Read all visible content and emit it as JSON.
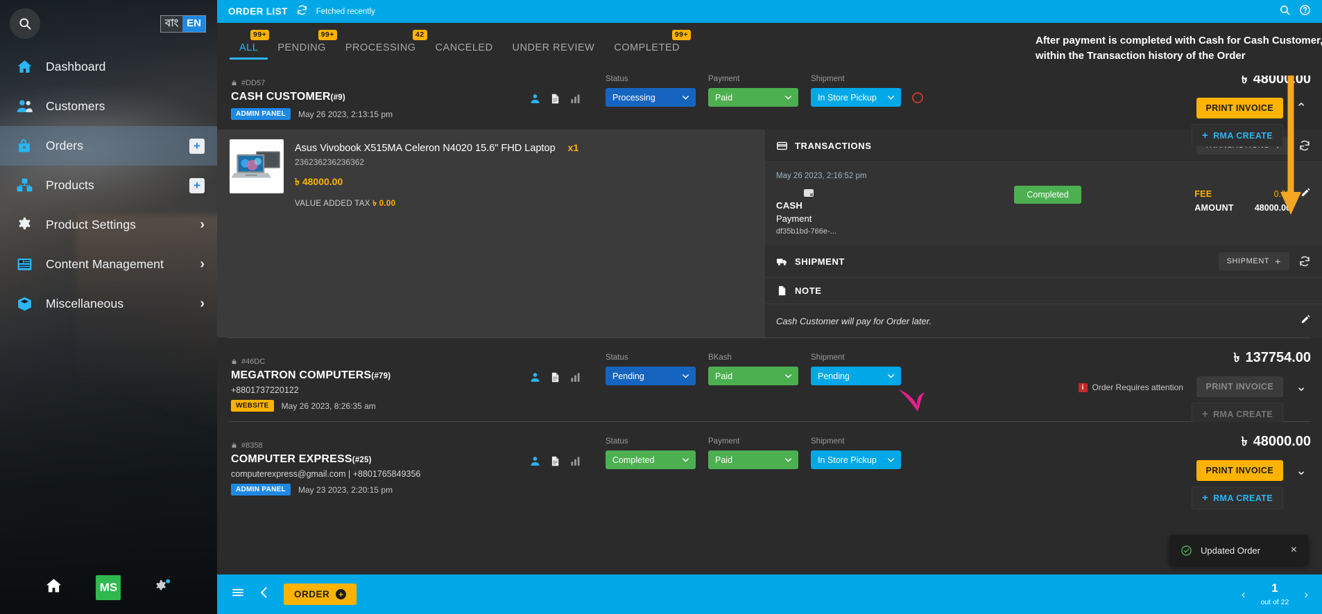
{
  "sidebar": {
    "search_icon": "search-icon",
    "lang": {
      "bn": "বাং",
      "en": "EN"
    },
    "items": [
      {
        "label": "Dashboard",
        "icon": "home-icon",
        "badge": null,
        "chevron": false,
        "active": false
      },
      {
        "label": "Customers",
        "icon": "customers-icon",
        "badge": null,
        "chevron": false,
        "active": false
      },
      {
        "label": "Orders",
        "icon": "orders-icon",
        "badge": "+",
        "chevron": false,
        "active": true
      },
      {
        "label": "Products",
        "icon": "products-icon",
        "badge": "+",
        "chevron": false,
        "active": false
      },
      {
        "label": "Product Settings",
        "icon": "gear-icon",
        "badge": null,
        "chevron": true,
        "active": false
      },
      {
        "label": "Content Management",
        "icon": "content-icon",
        "badge": null,
        "chevron": true,
        "active": false
      },
      {
        "label": "Miscellaneous",
        "icon": "misc-icon",
        "badge": null,
        "chevron": true,
        "active": false
      }
    ],
    "bottom": {
      "home": "home-icon",
      "brand": "MS",
      "settings": "settings-icon"
    }
  },
  "topbar": {
    "title": "ORDER LIST",
    "refresh_icon": "refresh-icon",
    "fetch_status": "Fetched recently",
    "search_icon": "search-icon",
    "help_icon": "help-icon"
  },
  "tabs": [
    {
      "label": "ALL",
      "badge": "99+",
      "active": true
    },
    {
      "label": "PENDING",
      "badge": "99+",
      "active": false
    },
    {
      "label": "PROCESSING",
      "badge": "42",
      "active": false
    },
    {
      "label": "CANCELED",
      "badge": null,
      "active": false
    },
    {
      "label": "UNDER REVIEW",
      "badge": null,
      "active": false
    },
    {
      "label": "COMPLETED",
      "badge": "99+",
      "active": false
    }
  ],
  "callout": {
    "text": "After payment is completed with Cash for Cash Customer, it will show within the Transaction history of the Order"
  },
  "orders": [
    {
      "id": "#DD57",
      "customer": "CASH CUSTOMER",
      "customer_num": "(#9)",
      "contact": "",
      "source_chip": "ADMIN PANEL",
      "source_type": "admin",
      "date": "May 26 2023, 2:13:15 pm",
      "status_label": "Status",
      "status_value": "Processing",
      "status_color": "blue",
      "payment_label": "Payment",
      "payment_value": "Paid",
      "payment_color": "green",
      "shipment_label": "Shipment",
      "shipment_value": "In Store Pickup",
      "shipment_color": "cyan",
      "total": "48000.00",
      "currency": "৳",
      "print_label": "PRINT INVOICE",
      "rma_label": "RMA CREATE",
      "attention": null,
      "expanded": true
    },
    {
      "id": "#46DC",
      "customer": "MEGATRON COMPUTERS",
      "customer_num": "(#79)",
      "contact": "+8801737220122",
      "source_chip": "WEBSITE",
      "source_type": "website",
      "date": "May 26 2023, 8:26:35 am",
      "status_label": "Status",
      "status_value": "Pending",
      "status_color": "blue",
      "payment_label": "BKash",
      "payment_value": "Paid",
      "payment_color": "green",
      "shipment_label": "Shipment",
      "shipment_value": "Pending",
      "shipment_color": "cyan",
      "total": "137754.00",
      "currency": "৳",
      "print_label": "PRINT INVOICE",
      "rma_label": "RMA CREATE",
      "attention": "Order Requires attention",
      "expanded": false
    },
    {
      "id": "#8358",
      "customer": "COMPUTER EXPRESS",
      "customer_num": "(#25)",
      "contact": "computerexpress@gmail.com | +8801765849356",
      "source_chip": "ADMIN PANEL",
      "source_type": "admin",
      "date": "May 23 2023, 2:20:15 pm",
      "status_label": "Status",
      "status_value": "Completed",
      "status_color": "green",
      "payment_label": "Payment",
      "payment_value": "Paid",
      "payment_color": "green",
      "shipment_label": "Shipment",
      "shipment_value": "In Store Pickup",
      "shipment_color": "cyan",
      "total": "48000.00",
      "currency": "৳",
      "print_label": "PRINT INVOICE",
      "rma_label": "RMA CREATE",
      "attention": null,
      "expanded": false
    }
  ],
  "item": {
    "title": "Asus Vivobook X515MA Celeron N4020 15.6\" FHD Laptop",
    "sku": "236236236236362",
    "qty": "x1",
    "price": "৳ 48000.00",
    "vat_label": "VALUE ADDED TAX",
    "vat_value": "৳ 0.00"
  },
  "detail": {
    "transactions_title": "TRANSACTIONS",
    "transactions_btn": "TRANSACTIONS",
    "shipment_title": "SHIPMENT",
    "shipment_btn": "SHIPMENT",
    "note_title": "NOTE",
    "note_text": "Cash Customer will pay for Order later.",
    "transaction": {
      "date": "May 26 2023, 2:16:52 pm",
      "method": "CASH",
      "type": "Payment",
      "hash": "df35b1bd-766e-...",
      "status": "Completed",
      "fee_label": "FEE",
      "fee_value": "0.00",
      "amount_label": "AMOUNT",
      "amount_value": "48000.00"
    }
  },
  "bottombar": {
    "menu_icon": "menu-icon",
    "back_icon": "chevron-left-icon",
    "order_label": "ORDER",
    "page": "1",
    "page_of": "out of 22"
  },
  "toast": {
    "message": "Updated Order",
    "icon": "check-circle-icon",
    "close": "×"
  },
  "colors": {
    "accent": "#00a8e8",
    "warning": "#ffb300",
    "success": "#4caf50",
    "info": "#1565c0",
    "danger": "#c62828"
  }
}
